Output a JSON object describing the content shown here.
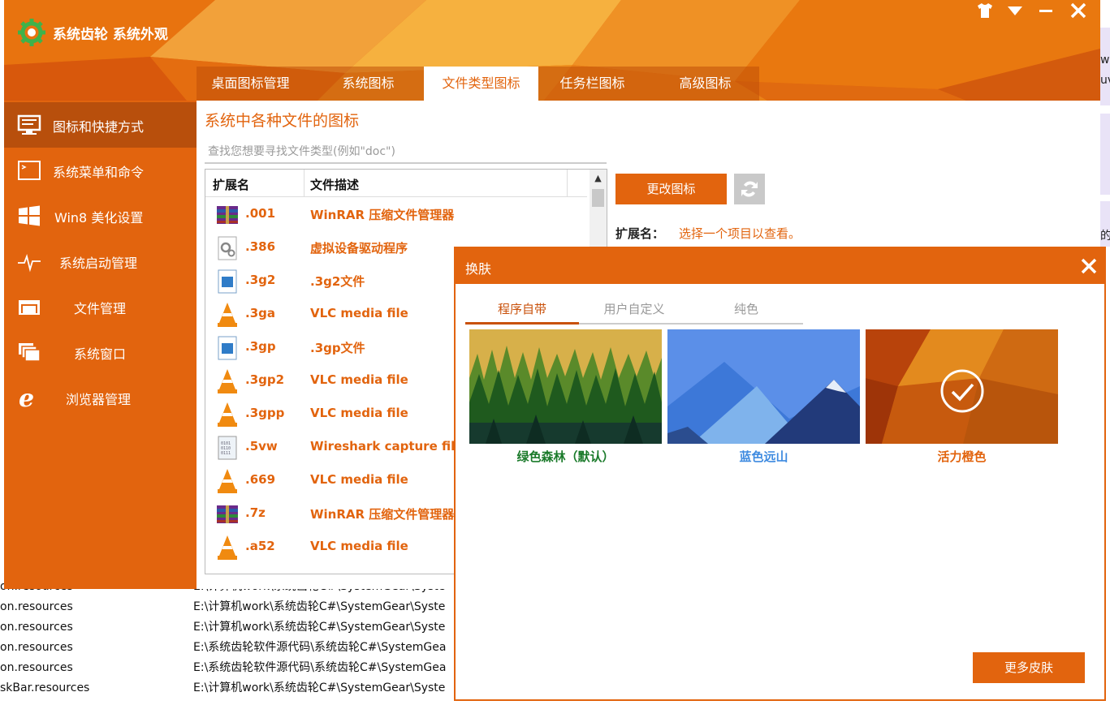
{
  "background_window": {
    "rows": [
      {
        "name": "on.resources",
        "path": "E:\\计算机work\\系统齿轮C#\\SystemGear\\Syste"
      },
      {
        "name": "on.resources",
        "path": "E:\\计算机work\\系统齿轮C#\\SystemGear\\Syste"
      },
      {
        "name": "on.resources",
        "path": "E:\\计算机work\\系统齿轮C#\\SystemGear\\Syste"
      },
      {
        "name": "on.resources",
        "path": "E:\\系统齿轮软件源代码\\系统齿轮C#\\SystemGea"
      },
      {
        "name": "on.resources",
        "path": "E:\\系统齿轮软件源代码\\系统齿轮C#\\SystemGea"
      },
      {
        "name": "skBar.resources",
        "path": "E:\\计算机work\\系统齿轮C#\\SystemGear\\Syste"
      }
    ],
    "right_fragments": [
      "w",
      "uv",
      "的"
    ]
  },
  "app": {
    "title": "系统齿轮 系统外观",
    "accent": "#e2640e"
  },
  "tabs": [
    {
      "label": "桌面图标管理",
      "active": false
    },
    {
      "label": "系统图标",
      "active": false
    },
    {
      "label": "文件类型图标",
      "active": true
    },
    {
      "label": "任务栏图标",
      "active": false
    },
    {
      "label": "高级图标",
      "active": false
    }
  ],
  "sidebar": {
    "items": [
      {
        "label": "图标和快捷方式",
        "icon": "monitor-icon",
        "active": true
      },
      {
        "label": "系统菜单和命令",
        "icon": "terminal-icon",
        "active": false
      },
      {
        "label": "Win8 美化设置",
        "icon": "windows-logo-icon",
        "active": false
      },
      {
        "label": "系统启动管理",
        "icon": "pulse-icon",
        "active": false
      },
      {
        "label": "文件管理",
        "icon": "folder-icon",
        "active": false
      },
      {
        "label": "系统窗口",
        "icon": "windows-stack-icon",
        "active": false
      },
      {
        "label": "浏览器管理",
        "icon": "ie-browser-icon",
        "active": false
      }
    ]
  },
  "content": {
    "title": "系统中各种文件的图标",
    "search_placeholder": "查找您想要寻找文件类型(例如\"doc\")",
    "columns": [
      "扩展名",
      "文件描述"
    ],
    "rows": [
      {
        "ext": ".001",
        "desc": "WinRAR 压缩文件管理器",
        "icon": "winrar-icon"
      },
      {
        "ext": ".386",
        "desc": "虚拟设备驱动程序",
        "icon": "gear-file-icon"
      },
      {
        "ext": ".3g2",
        "desc": ".3g2文件",
        "icon": "video-file-icon"
      },
      {
        "ext": ".3ga",
        "desc": "VLC media file",
        "icon": "vlc-icon"
      },
      {
        "ext": ".3gp",
        "desc": ".3gp文件",
        "icon": "video-file-icon"
      },
      {
        "ext": ".3gp2",
        "desc": "VLC media file",
        "icon": "vlc-icon"
      },
      {
        "ext": ".3gpp",
        "desc": "VLC media file",
        "icon": "vlc-icon"
      },
      {
        "ext": ".5vw",
        "desc": "Wireshark capture file",
        "icon": "binary-file-icon"
      },
      {
        "ext": ".669",
        "desc": "VLC media file",
        "icon": "vlc-icon"
      },
      {
        "ext": ".7z",
        "desc": "WinRAR 压缩文件管理器",
        "icon": "winrar-icon"
      },
      {
        "ext": ".a52",
        "desc": "VLC media file",
        "icon": "vlc-icon"
      }
    ],
    "change_button": "更改图标",
    "ext_label": "扩展名：",
    "ext_value": "选择一个项目以查看。"
  },
  "skin_dialog": {
    "title": "换肤",
    "tabs": [
      {
        "label": "程序自带",
        "active": true
      },
      {
        "label": "用户自定义",
        "active": false
      },
      {
        "label": "纯色",
        "active": false
      }
    ],
    "skins": [
      {
        "caption": "绿色森林（默认）",
        "caption_color": "#1a7a2a",
        "selected": false
      },
      {
        "caption": "蓝色远山",
        "caption_color": "#3f8be0",
        "selected": false
      },
      {
        "caption": "活力橙色",
        "caption_color": "#e2640e",
        "selected": true
      }
    ],
    "more_button": "更多皮肤"
  }
}
